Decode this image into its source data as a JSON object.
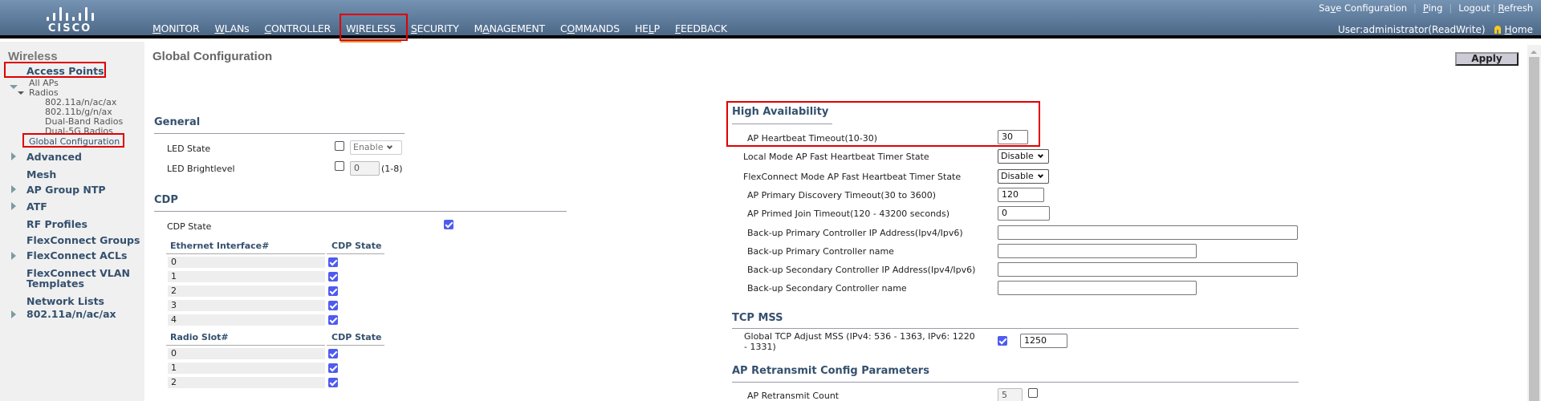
{
  "header": {
    "logo_text": "CISCO",
    "nav": [
      {
        "pre": "",
        "u": "M",
        "post": "ONITOR"
      },
      {
        "pre": "",
        "u": "W",
        "post": "LANs"
      },
      {
        "pre": "",
        "u": "C",
        "post": "ONTROLLER"
      },
      {
        "pre": "W",
        "u": "I",
        "post": "RELESS"
      },
      {
        "pre": "",
        "u": "S",
        "post": "ECURITY"
      },
      {
        "pre": "M",
        "u": "A",
        "post": "NAGEMENT"
      },
      {
        "pre": "C",
        "u": "O",
        "post": "MMANDS"
      },
      {
        "pre": "HE",
        "u": "L",
        "post": "P"
      },
      {
        "pre": "",
        "u": "F",
        "post": "EEDBACK"
      }
    ],
    "active_nav": "WIRELESS",
    "links": {
      "save_pre": "Sa",
      "save_u": "v",
      "save_post": "e Configuration",
      "ping_u": "P",
      "ping_post": "ing",
      "logout_pre": "Lo",
      "logout_u": "g",
      "logout_post": "out",
      "refresh_u": "R",
      "refresh_post": "efresh"
    },
    "user": "User:administrator(ReadWrite)",
    "home_u": "H",
    "home_post": "ome"
  },
  "sidebar": {
    "title": "Wireless",
    "access_points": "Access Points",
    "all_aps": "All APs",
    "radios": "Radios",
    "radio_items": [
      "802.11a/n/ac/ax",
      "802.11b/g/n/ax",
      "Dual-Band Radios",
      "Dual-5G Radios"
    ],
    "global_config": "Global Configuration",
    "items": [
      {
        "label": "Advanced",
        "expandable": true
      },
      {
        "label": "Mesh",
        "expandable": false
      },
      {
        "label": "AP Group NTP",
        "expandable": true
      },
      {
        "label": "ATF",
        "expandable": true
      },
      {
        "label": "RF Profiles",
        "expandable": false
      },
      {
        "label": "FlexConnect Groups",
        "expandable": false
      },
      {
        "label": "FlexConnect ACLs",
        "expandable": true
      },
      {
        "label": "FlexConnect VLAN",
        "expandable": false
      },
      {
        "label": "Templates",
        "expandable": false
      },
      {
        "label": "Network Lists",
        "expandable": false
      },
      {
        "label": "802.11a/n/ac/ax",
        "expandable": true
      }
    ]
  },
  "main": {
    "title": "Global Configuration",
    "apply": "Apply",
    "general": {
      "heading": "General",
      "led_state_label": "LED State",
      "led_state_checked": false,
      "led_state_value": "Enable",
      "led_bright_label": "LED Brightlevel",
      "led_bright_checked": false,
      "led_bright_value": "0",
      "led_bright_range": "(1-8)"
    },
    "cdp": {
      "heading": "CDP",
      "state_label": "CDP State",
      "state_checked": true,
      "eth_header": "Ethernet Interface#",
      "cdp_header": "CDP State",
      "eth_rows": [
        {
          "id": "0",
          "checked": true
        },
        {
          "id": "1",
          "checked": true
        },
        {
          "id": "2",
          "checked": true
        },
        {
          "id": "3",
          "checked": true
        },
        {
          "id": "4",
          "checked": true
        }
      ],
      "radio_header": "Radio Slot#",
      "radio_cdp_header": "CDP State",
      "radio_rows": [
        {
          "id": "0",
          "checked": true
        },
        {
          "id": "1",
          "checked": true
        },
        {
          "id": "2",
          "checked": true
        }
      ]
    },
    "ha": {
      "heading": "High Availability",
      "heartbeat_label": "AP Heartbeat Timeout(10-30)",
      "heartbeat_value": "30",
      "local_fast_label": "Local Mode AP Fast Heartbeat Timer State",
      "local_fast_value": "Disable",
      "flex_fast_label": "FlexConnect Mode AP Fast Heartbeat Timer State",
      "flex_fast_value": "Disable",
      "primary_disc_label": "AP Primary Discovery Timeout(30 to 3600)",
      "primary_disc_value": "120",
      "primed_join_label": "AP Primed Join Timeout(120 - 43200 seconds)",
      "primed_join_value": "0",
      "bk_pri_ip_label": "Back-up Primary Controller IP Address(Ipv4/Ipv6)",
      "bk_pri_ip_value": "",
      "bk_pri_name_label": "Back-up Primary Controller name",
      "bk_pri_name_value": "",
      "bk_sec_ip_label": "Back-up Secondary Controller IP Address(Ipv4/Ipv6)",
      "bk_sec_ip_value": "",
      "bk_sec_name_label": "Back-up Secondary Controller name",
      "bk_sec_name_value": ""
    },
    "tcp": {
      "heading": "TCP MSS",
      "label_line1": "Global TCP Adjust MSS (IPv4: 536 - 1363, IPv6: 1220",
      "label_line2": "- 1331)",
      "checked": true,
      "value": "1250"
    },
    "retransmit": {
      "heading": "AP Retransmit Config Parameters",
      "count_label": "AP Retransmit Count",
      "count_value": "5",
      "count_checked": false
    }
  }
}
